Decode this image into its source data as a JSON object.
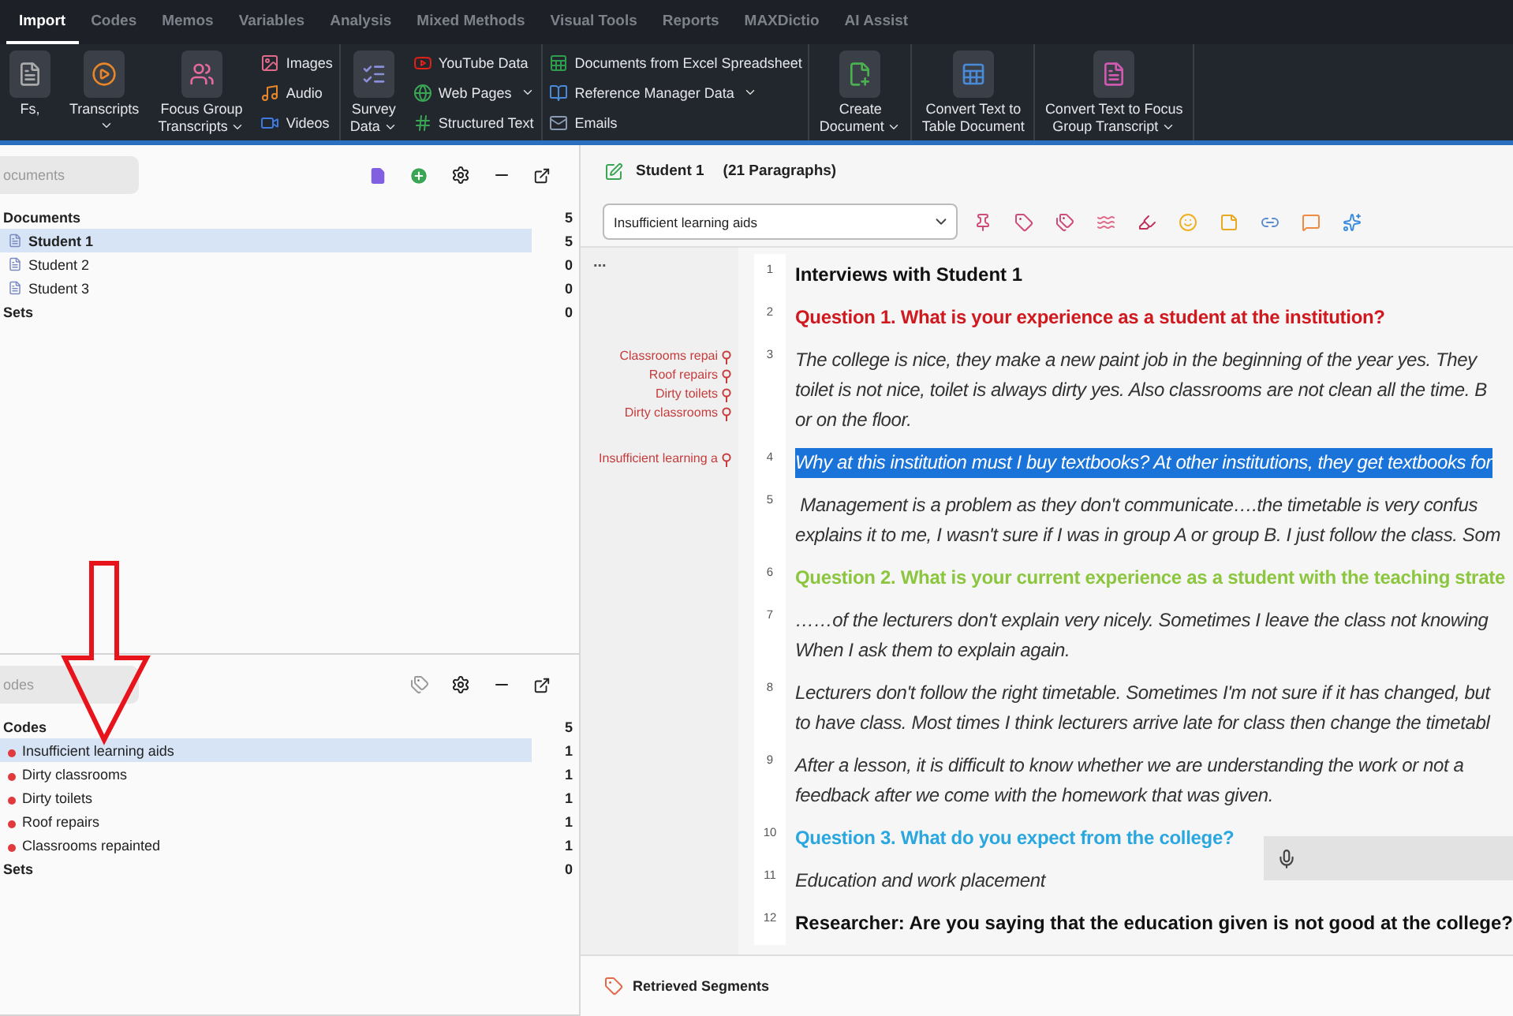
{
  "ribbon": {
    "tabs": [
      {
        "label": "Import",
        "selected": true
      },
      {
        "label": "Codes",
        "selected": false
      },
      {
        "label": "Memos",
        "selected": false
      },
      {
        "label": "Variables",
        "selected": false
      },
      {
        "label": "Analysis",
        "selected": false
      },
      {
        "label": "Mixed Methods",
        "selected": false
      },
      {
        "label": "Visual Tools",
        "selected": false
      },
      {
        "label": "Reports",
        "selected": false
      },
      {
        "label": "MAXDictio",
        "selected": false
      },
      {
        "label": "AI Assist",
        "selected": false
      }
    ],
    "groups": [
      {
        "kind": "large",
        "lines": [
          "Fs,"
        ],
        "dropdown": false
      },
      {
        "kind": "large",
        "lines": [
          "Transcripts"
        ],
        "dropdown": true
      },
      {
        "kind": "large",
        "lines": [
          "Focus Group",
          "Transcripts"
        ],
        "dropdown": true
      },
      {
        "kind": "stack",
        "items": [
          {
            "label": "Images",
            "dropdown": false
          },
          {
            "label": "Audio",
            "dropdown": false
          },
          {
            "label": "Videos",
            "dropdown": false
          }
        ]
      },
      {
        "kind": "large",
        "lines": [
          "Survey",
          "Data"
        ],
        "dropdown": true
      },
      {
        "kind": "stack",
        "items": [
          {
            "label": "YouTube Data",
            "dropdown": false
          },
          {
            "label": "Web Pages",
            "dropdown": true
          },
          {
            "label": "Structured Text",
            "dropdown": false
          }
        ]
      },
      {
        "kind": "stack",
        "items": [
          {
            "label": "Documents from Excel Spreadsheet",
            "dropdown": false
          },
          {
            "label": "Reference Manager Data",
            "dropdown": true
          },
          {
            "label": "Emails",
            "dropdown": false
          }
        ]
      },
      {
        "kind": "large",
        "lines": [
          "Create",
          "Document"
        ],
        "dropdown": true
      },
      {
        "kind": "large",
        "lines": [
          "Convert Text to",
          "Table Document"
        ],
        "dropdown": false
      },
      {
        "kind": "large",
        "lines": [
          "Convert Text to Focus",
          "Group Transcript"
        ],
        "dropdown": true
      }
    ]
  },
  "documents_panel": {
    "search": {
      "placeholder": "ocuments"
    },
    "root": {
      "label": "Documents",
      "count": "5"
    },
    "items": [
      {
        "label": "Student 1",
        "count": "5",
        "selected": true
      },
      {
        "label": "Student 2",
        "count": "0",
        "selected": false
      },
      {
        "label": "Student 3",
        "count": "0",
        "selected": false
      }
    ],
    "sets": {
      "label": "Sets",
      "count": "0"
    }
  },
  "codes_panel": {
    "search": {
      "placeholder": "odes"
    },
    "root": {
      "label": "Codes",
      "count": "5"
    },
    "items": [
      {
        "label": "Insufficient learning aids",
        "count": "1",
        "color": "#e0393e",
        "selected": true
      },
      {
        "label": "Dirty classrooms",
        "count": "1",
        "color": "#e0393e",
        "selected": false
      },
      {
        "label": "Dirty toilets",
        "count": "1",
        "color": "#e0393e",
        "selected": false
      },
      {
        "label": "Roof repairs",
        "count": "1",
        "color": "#e0393e",
        "selected": false
      },
      {
        "label": "Classrooms repainted",
        "count": "1",
        "color": "#e0393e",
        "selected": false
      }
    ],
    "sets": {
      "label": "Sets",
      "count": "0"
    }
  },
  "document": {
    "title": "Student 1",
    "paragraph_count": "(21 Paragraphs)",
    "code_select": {
      "value": "Insufficient learning aids"
    },
    "margin_menu": "...",
    "paragraphs": [
      {
        "number": "1",
        "kind": "title",
        "selected": false,
        "lines": [
          "Interviews with Student 1"
        ]
      },
      {
        "number": "2",
        "kind": "question",
        "color": "#d0191f",
        "selected": false,
        "lines": [
          "Question 1. What is your experience as a student at the institution?"
        ]
      },
      {
        "number": "3",
        "kind": "answer",
        "selected": false,
        "codes": [
          {
            "label": "Classrooms repai"
          },
          {
            "label": "Roof repairs"
          },
          {
            "label": "Dirty toilets"
          },
          {
            "label": "Dirty classrooms"
          }
        ],
        "lines": [
          "The college is nice, they make a new paint job in the beginning of the year yes. They",
          "toilet is not nice, toilet is always dirty yes. Also classrooms are not clean all the time. B",
          "or on the floor."
        ]
      },
      {
        "number": "4",
        "kind": "answer",
        "selected": true,
        "codes": [
          {
            "label": "Insufficient learning a"
          }
        ],
        "lines": [
          "Why at this institution must I buy textbooks? At other institutions, they get textbooks for"
        ]
      },
      {
        "number": "5",
        "kind": "answer",
        "selected": false,
        "lines": [
          " Management is a problem as they don't communicate….the timetable is very confus",
          "explains it to me, I wasn't sure if I was in group A or group B. I just follow the class. Som"
        ]
      },
      {
        "number": "6",
        "kind": "question",
        "color": "#8cc63f",
        "selected": false,
        "lines": [
          "Question 2. What is your current experience as a student with the teaching strate"
        ]
      },
      {
        "number": "7",
        "kind": "answer",
        "selected": false,
        "lines": [
          "……of the lecturers don't explain very nicely. Sometimes I leave the class not knowing",
          "When I ask them to explain again."
        ]
      },
      {
        "number": "8",
        "kind": "answer",
        "selected": false,
        "lines": [
          "Lecturers don't follow the right timetable. Sometimes I'm not sure if it has changed, but",
          "to have class. Most times I think lecturers arrive late for class then change the timetabl"
        ]
      },
      {
        "number": "9",
        "kind": "answer",
        "selected": false,
        "lines": [
          "After a lesson, it is difficult to know whether we are understanding the work or not a",
          "feedback after we come with the homework that was given."
        ]
      },
      {
        "number": "10",
        "kind": "question",
        "color": "#2aa7df",
        "selected": false,
        "lines": [
          "Question 3. What do you expect from the college?"
        ]
      },
      {
        "number": "11",
        "kind": "answer",
        "selected": false,
        "lines": [
          "Education and work placement"
        ]
      },
      {
        "number": "12",
        "kind": "researcher",
        "selected": false,
        "lines": [
          "Researcher: Are you saying that the education given is not good at the college?"
        ]
      }
    ]
  },
  "retrieved_segments": {
    "title": "Retrieved Segments"
  }
}
